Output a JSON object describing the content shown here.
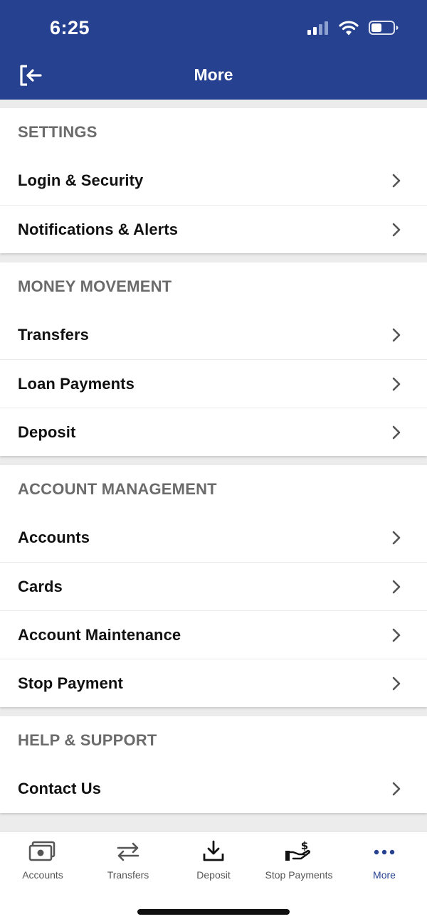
{
  "status_bar": {
    "time": "6:25"
  },
  "header": {
    "title": "More"
  },
  "sections": [
    {
      "title": "SETTINGS",
      "items": [
        "Login & Security",
        "Notifications & Alerts"
      ]
    },
    {
      "title": "MONEY MOVEMENT",
      "items": [
        "Transfers",
        "Loan Payments",
        "Deposit"
      ]
    },
    {
      "title": "ACCOUNT MANAGEMENT",
      "items": [
        "Accounts",
        "Cards",
        "Account Maintenance",
        "Stop Payment"
      ]
    },
    {
      "title": "HELP & SUPPORT",
      "items": [
        "Contact Us"
      ]
    }
  ],
  "tab_bar": {
    "tabs": [
      {
        "label": "Accounts",
        "icon": "accounts-icon"
      },
      {
        "label": "Transfers",
        "icon": "transfers-icon"
      },
      {
        "label": "Deposit",
        "icon": "deposit-icon"
      },
      {
        "label": "Stop Payments",
        "icon": "stop-payments-icon"
      },
      {
        "label": "More",
        "icon": "more-icon"
      }
    ],
    "active_tab": "More"
  },
  "colors": {
    "brand": "#26418f",
    "section_title": "#6b6b6b",
    "background": "#ececec"
  }
}
